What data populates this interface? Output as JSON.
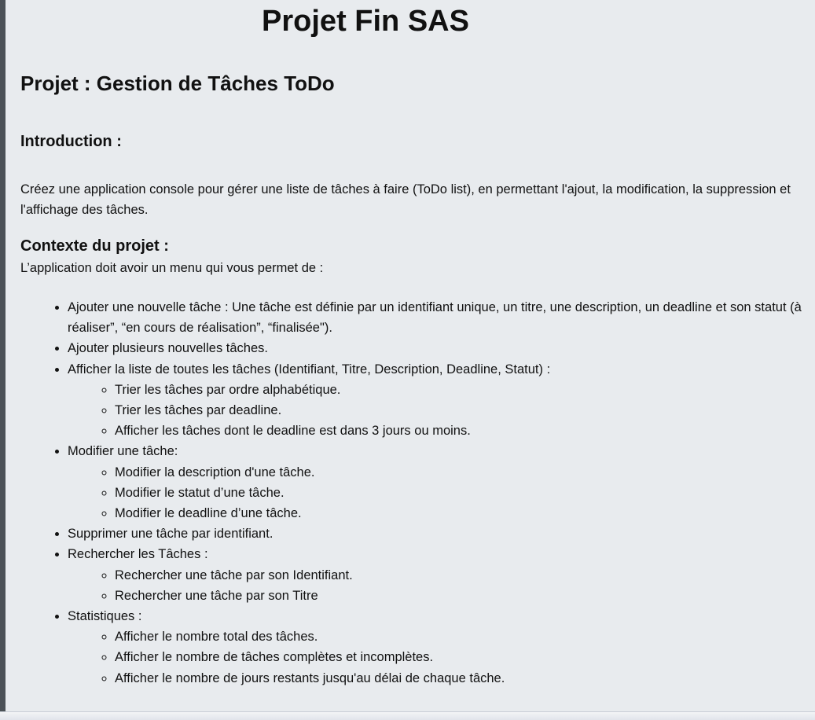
{
  "title": "Projet Fin SAS",
  "project_heading": "Projet : Gestion de Tâches ToDo",
  "introduction": {
    "heading": "Introduction :",
    "text": "Créez une application console pour gérer une liste de tâches à faire (ToDo list), en permettant l'ajout, la modification, la suppression et l'affichage des tâches."
  },
  "context": {
    "heading": "Contexte du projet :",
    "text": "L’application doit avoir un menu qui vous permet de :"
  },
  "menu": [
    {
      "label": "Ajouter une nouvelle tâche : Une tâche est définie par un identifiant unique, un titre, une description, un deadline et son statut (à réaliser”, “en cours de réalisation”,  “finalisée\")."
    },
    {
      "label": "Ajouter plusieurs nouvelles tâches."
    },
    {
      "label": "Afficher la liste de toutes les tâches (Identifiant, Titre, Description, Deadline, Statut) :",
      "sub": [
        "Trier les tâches par ordre alphabétique.",
        "Trier les tâches par deadline.",
        "Afficher les tâches dont le deadline est dans 3 jours ou moins."
      ]
    },
    {
      "label": "Modifier une tâche:",
      "sub": [
        "Modifier la description d'une tâche.",
        "Modifier le statut d’une tâche.",
        "Modifier le deadline d’une tâche."
      ]
    },
    {
      "label": "Supprimer une tâche par identifiant."
    },
    {
      "label": "Rechercher les Tâches :",
      "sub": [
        "Rechercher une tâche par son Identifiant.",
        "Rechercher une tâche par son Titre"
      ]
    },
    {
      "label": "Statistiques :",
      "sub": [
        "Afficher le nombre total des tâches.",
        "Afficher le nombre de tâches complètes et incomplètes.",
        "Afficher le nombre de jours restants jusqu'au délai de chaque tâche."
      ]
    }
  ]
}
